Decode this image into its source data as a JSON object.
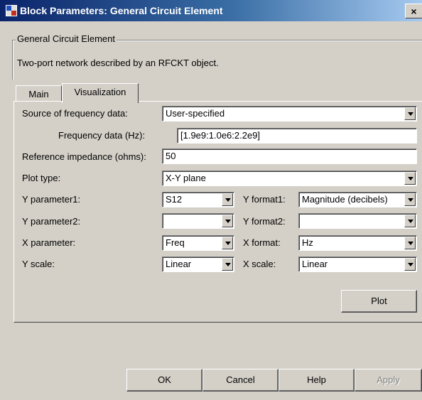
{
  "window": {
    "title": "Block Parameters: General Circuit Element",
    "close": "×"
  },
  "group": {
    "legend": "General Circuit Element",
    "description": "Two-port network described by an RFCKT object."
  },
  "tabs": [
    {
      "label": "Main",
      "active": false
    },
    {
      "label": "Visualization",
      "active": true
    }
  ],
  "form": {
    "source_label": "Source of frequency data:",
    "source_value": "User-specified",
    "freq_label": "Frequency data (Hz):",
    "freq_value": "[1.9e9:1.0e6:2.2e9]",
    "refimp_label": "Reference impedance (ohms):",
    "refimp_value": "50",
    "plottype_label": "Plot type:",
    "plottype_value": "X-Y plane",
    "yparam1_label": "Y parameter1:",
    "yparam1_value": "S12",
    "yformat1_label": "Y format1:",
    "yformat1_value": "Magnitude (decibels)",
    "yparam2_label": "Y parameter2:",
    "yparam2_value": "",
    "yformat2_label": "Y format2:",
    "yformat2_value": "",
    "xparam_label": "X parameter:",
    "xparam_value": "Freq",
    "xformat_label": "X format:",
    "xformat_value": "Hz",
    "yscale_label": "Y scale:",
    "yscale_value": "Linear",
    "xscale_label": "X scale:",
    "xscale_value": "Linear",
    "plot_button": "Plot"
  },
  "buttons": {
    "ok": "OK",
    "cancel": "Cancel",
    "help": "Help",
    "apply": "Apply"
  },
  "colors": {
    "titlebar": "#0a246a",
    "face": "#d4d0c8"
  }
}
